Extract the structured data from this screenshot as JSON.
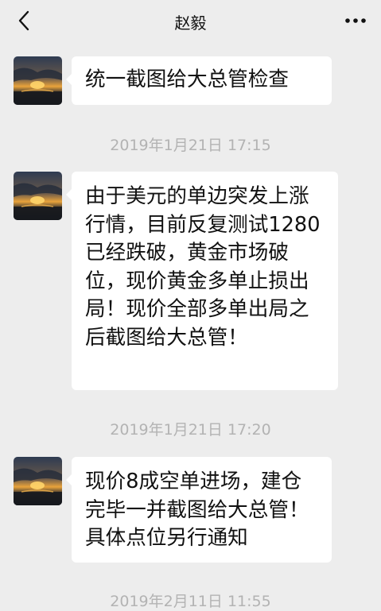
{
  "header": {
    "title": "赵毅",
    "back_icon": "chevron-left-icon",
    "more_icon": "more-dots-icon"
  },
  "messages": [
    {
      "sender_avatar": "sunset-avatar",
      "text": "统一截图给大总管检查"
    },
    {
      "timestamp": "2019年1月21日 17:15",
      "sender_avatar": "sunset-avatar",
      "text": "由于美元的单边突发上涨行情，目前反复测试1280已经跌破，黄金市场破位，现价黄金多单止损出局！现价全部多单出局之后截图给大总管！"
    },
    {
      "timestamp": "2019年1月21日 17:20",
      "sender_avatar": "sunset-avatar",
      "text": "现价8成空单进场，建仓完毕一并截图给大总管！具体点位另行通知"
    },
    {
      "timestamp": "2019年2月11日 11:55"
    }
  ],
  "colors": {
    "background": "#ededed",
    "bubble": "#ffffff",
    "timestamp": "#b3b3b3"
  }
}
